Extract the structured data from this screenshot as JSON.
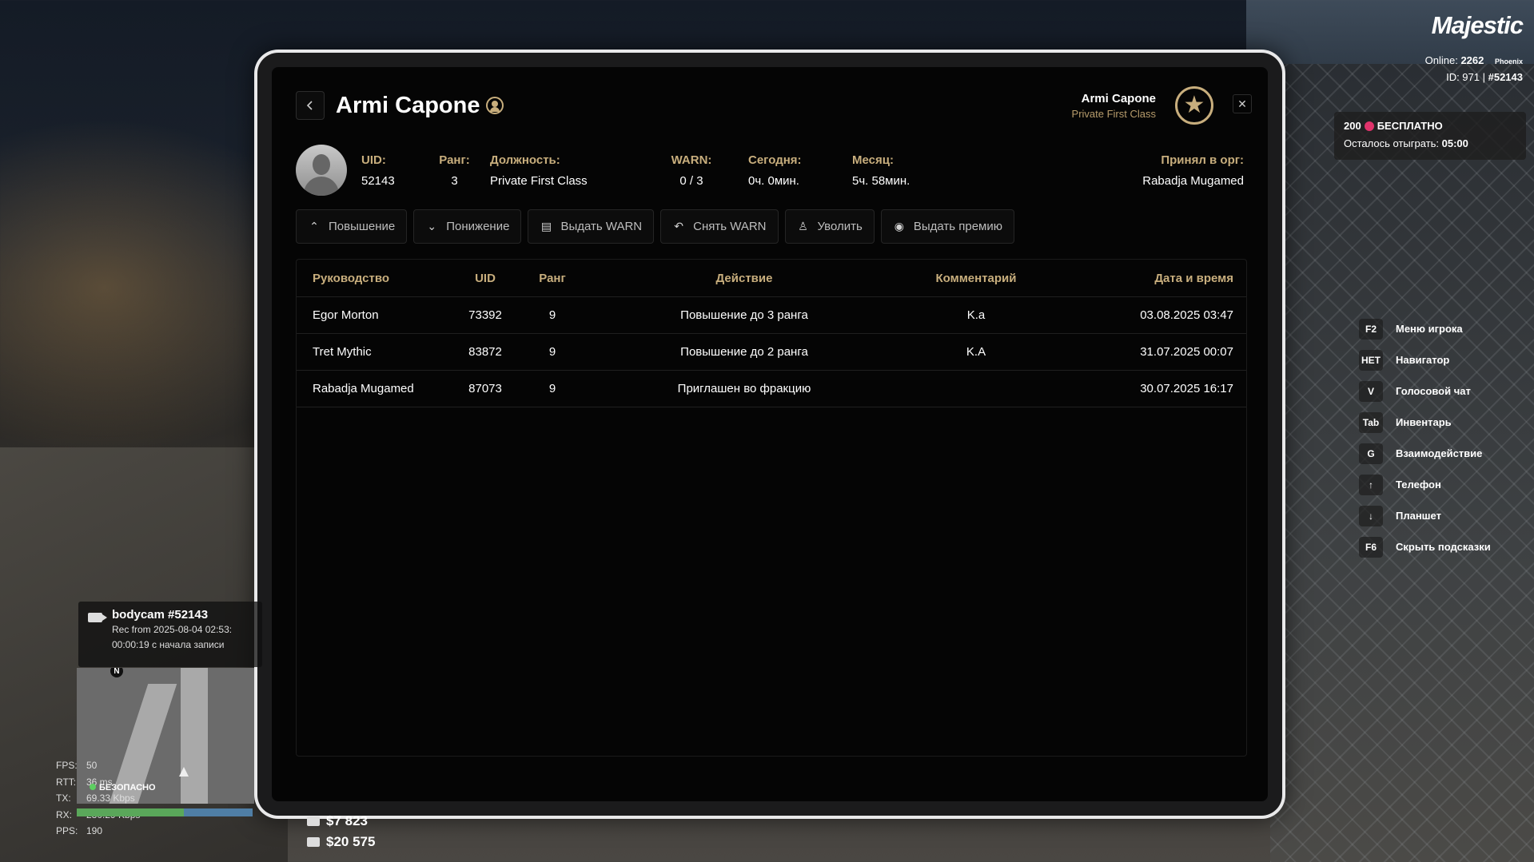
{
  "tablet": {
    "player_name": "Armi Capone",
    "header_name": "Armi Capone",
    "header_rank": "Private First Class",
    "close": "✕",
    "info": [
      {
        "label": "UID:",
        "value": "52143"
      },
      {
        "label": "Ранг:",
        "value": "3"
      },
      {
        "label": "Должность:",
        "value": "Private First Class"
      },
      {
        "label": "WARN:",
        "value": "0 / 3"
      },
      {
        "label": "Сегодня:",
        "value": "0ч. 0мин."
      },
      {
        "label": "Месяц:",
        "value": "5ч. 58мин."
      },
      {
        "label": "Принял в орг:",
        "value": "Rabadja Mugamed"
      }
    ],
    "actions": [
      {
        "label": "Повышение",
        "icon": "chevron-up-icon"
      },
      {
        "label": "Понижение",
        "icon": "chevron-down-icon"
      },
      {
        "label": "Выдать WARN",
        "icon": "warn-document-icon"
      },
      {
        "label": "Снять WARN",
        "icon": "undo-icon"
      },
      {
        "label": "Уволить",
        "icon": "fire-person-icon"
      },
      {
        "label": "Выдать премию",
        "icon": "coin-icon"
      }
    ],
    "table": {
      "headers": [
        "Руководство",
        "UID",
        "Ранг",
        "Действие",
        "Комментарий",
        "Дата и время"
      ],
      "rows": [
        [
          "Egor Morton",
          "73392",
          "9",
          "Повышение до 3 ранга",
          "K.a",
          "03.08.2025 03:47"
        ],
        [
          "Tret Mythic",
          "83872",
          "9",
          "Повышение до 2 ранга",
          "K.A",
          "31.07.2025 00:07"
        ],
        [
          "Rabadja Mugamed",
          "87073",
          "9",
          "Приглашен во фракцию",
          "",
          "30.07.2025 16:17"
        ]
      ]
    }
  },
  "hud": {
    "logo": "Majestic",
    "online_label": "Online:",
    "online_count": "2262",
    "server": "Phoenix",
    "id_text": "ID: 971 |",
    "id_hash": "#52143",
    "promo_amount": "200",
    "promo_text": "БЕСПЛАТНО",
    "promo_remaining_label": "Осталось отыграть:",
    "promo_remaining_value": "05:00",
    "hints": [
      {
        "key": "F2",
        "label": "Меню игрока"
      },
      {
        "key": "НЕТ",
        "label": "Навигатор"
      },
      {
        "key": "V",
        "label": "Голосовой чат"
      },
      {
        "key": "Tab",
        "label": "Инвентарь"
      },
      {
        "key": "G",
        "label": "Взаимодействие"
      },
      {
        "key": "↑",
        "label": "Телефон"
      },
      {
        "key": "↓",
        "label": "Планшет"
      },
      {
        "key": "F6",
        "label": "Скрыть подсказки"
      }
    ],
    "bodycam": {
      "title": "bodycam #52143",
      "line1": "Rec from 2025-08-04 02:53:",
      "line2": "00:00:19 с начала записи"
    },
    "minimap_north": "N",
    "safe_zone": "БЕЗОПАСНО",
    "net": [
      {
        "label": "FPS:",
        "value": "50"
      },
      {
        "label": "RTT:",
        "value": "36 ms"
      },
      {
        "label": "TX:",
        "value": "69.33 Kbps"
      },
      {
        "label": "RX:",
        "value": "230.29 Kbps"
      },
      {
        "label": "PPS:",
        "value": "190"
      }
    ],
    "money_cash": "$7 823",
    "money_bank": "$20 575"
  }
}
